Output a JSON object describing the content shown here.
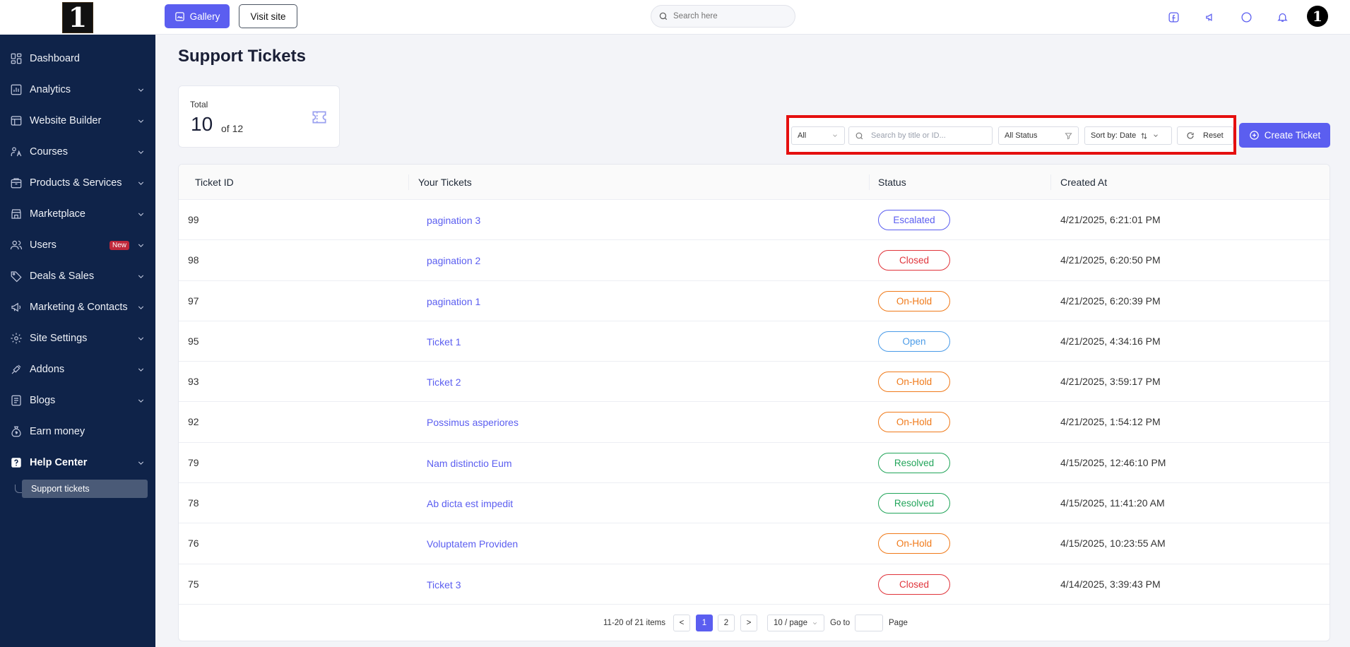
{
  "logo_text": "1",
  "sidebar": {
    "items": [
      {
        "label": "Dashboard",
        "icon": "dashboard-icon"
      },
      {
        "label": "Analytics",
        "icon": "analytics-icon"
      },
      {
        "label": "Website Builder",
        "icon": "website-builder-icon"
      },
      {
        "label": "Courses",
        "icon": "courses-icon"
      },
      {
        "label": "Products & Services",
        "icon": "products-icon"
      },
      {
        "label": "Marketplace",
        "icon": "marketplace-icon"
      },
      {
        "label": "Users",
        "icon": "users-icon",
        "badge": "New"
      },
      {
        "label": "Deals & Sales",
        "icon": "deals-icon"
      },
      {
        "label": "Marketing & Contacts",
        "icon": "marketing-icon"
      },
      {
        "label": "Site Settings",
        "icon": "settings-icon"
      },
      {
        "label": "Addons",
        "icon": "addons-icon"
      },
      {
        "label": "Blogs",
        "icon": "blogs-icon"
      },
      {
        "label": "Earn money",
        "icon": "money-bag-icon"
      },
      {
        "label": "Help Center",
        "icon": "help-icon"
      }
    ],
    "sub_item": "Support tickets"
  },
  "topbar": {
    "gallery_label": "Gallery",
    "visit_label": "Visit site",
    "search_placeholder": "Search here",
    "avatar_text": "1"
  },
  "page": {
    "title": "Support Tickets",
    "stat_label": "Total",
    "stat_value": "10",
    "stat_of": "of 12"
  },
  "filters": {
    "type_value": "All",
    "search_placeholder": "Search by title or ID...",
    "status_value": "All Status",
    "sort_value": "Sort by: Date",
    "reset_label": "Reset"
  },
  "create_label": "Create Ticket",
  "table": {
    "headers": [
      "Ticket ID",
      "Your Tickets",
      "Status",
      "Created At"
    ],
    "rows": [
      {
        "id": "99",
        "title": "pagination 3",
        "status": "Escalated",
        "date": "4/21/2025, 6:21:01 PM"
      },
      {
        "id": "98",
        "title": "pagination 2",
        "status": "Closed",
        "date": "4/21/2025, 6:20:50 PM"
      },
      {
        "id": "97",
        "title": "pagination 1",
        "status": "On-Hold",
        "date": "4/21/2025, 6:20:39 PM"
      },
      {
        "id": "95",
        "title": "Ticket 1",
        "status": "Open",
        "date": "4/21/2025, 4:34:16 PM"
      },
      {
        "id": "93",
        "title": "Ticket 2",
        "status": "On-Hold",
        "date": "4/21/2025, 3:59:17 PM"
      },
      {
        "id": "92",
        "title": "Possimus asperiores",
        "status": "On-Hold",
        "date": "4/21/2025, 1:54:12 PM"
      },
      {
        "id": "79",
        "title": "Nam distinctio Eum",
        "status": "Resolved",
        "date": "4/15/2025, 12:46:10 PM"
      },
      {
        "id": "78",
        "title": "Ab dicta est impedit",
        "status": "Resolved",
        "date": "4/15/2025, 11:41:20 AM"
      },
      {
        "id": "76",
        "title": "Voluptatem Providen",
        "status": "On-Hold",
        "date": "4/15/2025, 10:23:55 AM"
      },
      {
        "id": "75",
        "title": "Ticket 3",
        "status": "Closed",
        "date": "4/14/2025, 3:39:43 PM"
      }
    ]
  },
  "status_colors": {
    "Escalated": "#5b5ef0",
    "Closed": "#e0343b",
    "On-Hold": "#f07a1a",
    "Open": "#4a9be8",
    "Resolved": "#22a55a"
  },
  "pagination": {
    "range_text": "11-20 of 21 items",
    "prev": "<",
    "pages": [
      "1",
      "2"
    ],
    "current": "1",
    "next": ">",
    "page_size": "10 / page",
    "goto_label": "Go to",
    "page_label": "Page"
  }
}
